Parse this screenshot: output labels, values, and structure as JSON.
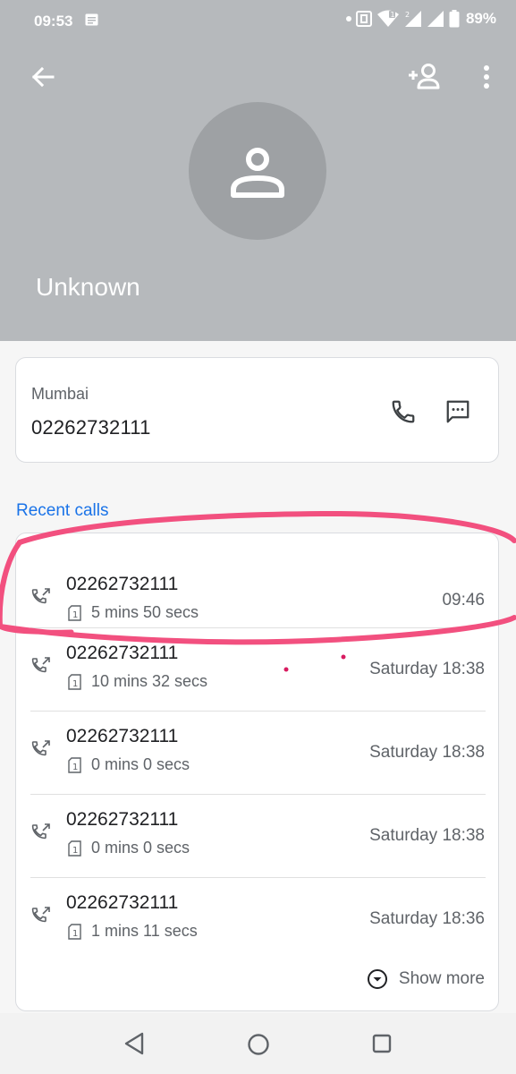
{
  "status_bar": {
    "time": "09:53",
    "battery": "89%"
  },
  "header": {
    "contact_name": "Unknown",
    "icons": [
      "back-arrow-icon",
      "add-contact-icon",
      "more-vert-icon",
      "person-icon"
    ]
  },
  "contact_card": {
    "location": "Mumbai",
    "phone_number": "02262732111",
    "icons": [
      "phone-icon",
      "message-icon"
    ]
  },
  "recent_calls": {
    "title": "Recent calls",
    "calls": [
      {
        "number": "02262732111",
        "duration": "5 mins 50 secs",
        "time": "09:46",
        "direction": "outgoing"
      },
      {
        "number": "02262732111",
        "duration": "10 mins 32 secs",
        "time": "Saturday 18:38",
        "direction": "outgoing"
      },
      {
        "number": "02262732111",
        "duration": "0 mins 0 secs",
        "time": "Saturday 18:38",
        "direction": "outgoing"
      },
      {
        "number": "02262732111",
        "duration": "0 mins 0 secs",
        "time": "Saturday 18:38",
        "direction": "outgoing"
      },
      {
        "number": "02262732111",
        "duration": "1 mins 11 secs",
        "time": "Saturday 18:36",
        "direction": "outgoing"
      }
    ],
    "show_more_label": "Show more"
  },
  "colors": {
    "header_bg": "#b6b9bc",
    "accent": "#1a73e8",
    "annotation": "#f2507f"
  },
  "nav_bar": {
    "icons": [
      "nav-back-icon",
      "nav-home-icon",
      "nav-recents-icon"
    ]
  }
}
